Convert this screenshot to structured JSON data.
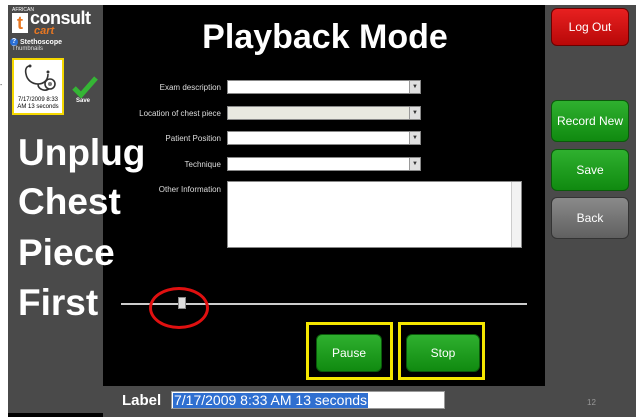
{
  "brand": {
    "small_text": "AFRICAN",
    "letter": "t",
    "name": "consult",
    "sub": "cart"
  },
  "device": {
    "help_glyph": "?",
    "name": "Stethoscope"
  },
  "thumbnails": {
    "label": "Thumbnails",
    "items": [
      {
        "text": "7/17/2009 8:33 AM 13 seconds"
      }
    ],
    "save_label": "Save"
  },
  "page_title": "Playback Mode",
  "form": {
    "exam_description_label": "Exam description",
    "location_label": "Location of chest piece",
    "position_label": "Patient Position",
    "technique_label": "Technique",
    "other_label": "Other Information",
    "arrow_glyph": "▼",
    "exam_description_value": "",
    "location_value": "",
    "position_value": "",
    "technique_value": "",
    "other_value": ""
  },
  "overlay_lines": [
    "Unplug",
    "Chest",
    "Piece",
    "First"
  ],
  "playback": {
    "position_fraction": 0.15,
    "pause_label": "Pause",
    "stop_label": "Stop"
  },
  "sidebar": {
    "logout_label": "Log Out",
    "record_new_label": "Record New",
    "save_label": "Save",
    "back_label": "Back"
  },
  "label_field": {
    "caption": "Label",
    "value": "7/17/2009 8:33 AM 13 seconds"
  },
  "page_number": "12",
  "colors": {
    "accent_orange": "#e87722",
    "green": "#1a9a1a",
    "red": "#d41010",
    "highlight_yellow": "#f5e600",
    "annotation_red": "#e01010"
  }
}
